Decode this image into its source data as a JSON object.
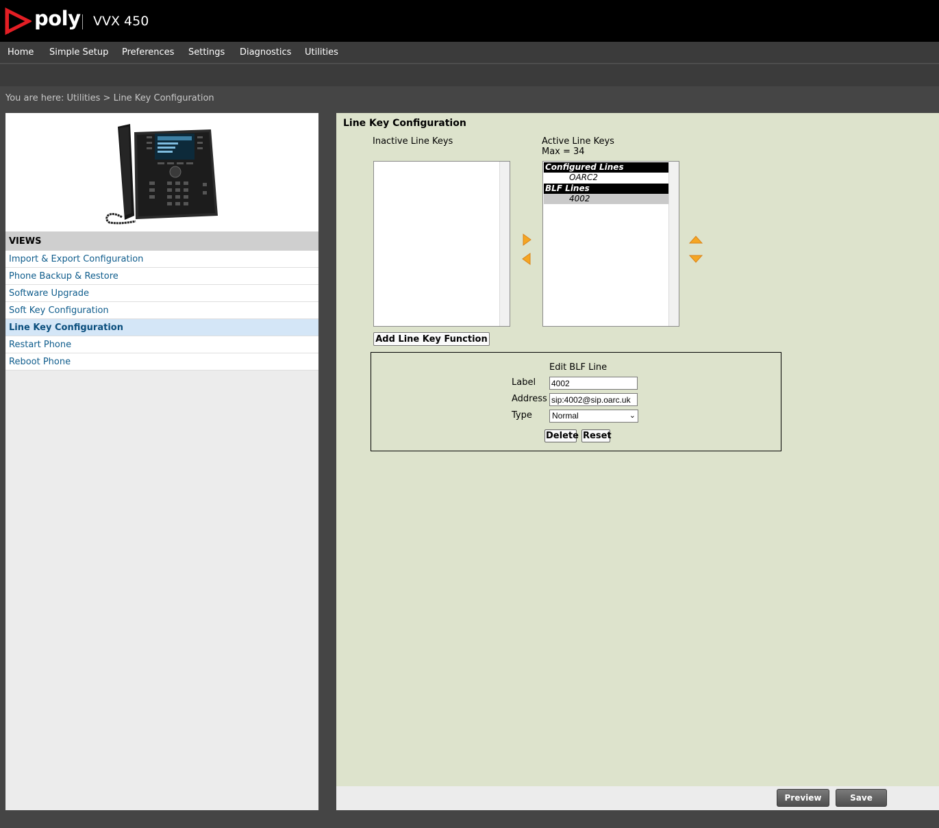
{
  "header": {
    "brand": "poly",
    "model": "VVX 450"
  },
  "nav": {
    "items": [
      "Home",
      "Simple Setup",
      "Preferences",
      "Settings",
      "Diagnostics",
      "Utilities"
    ]
  },
  "breadcrumb": "You are here: Utilities > Line Key Configuration",
  "sidebar": {
    "views_header": "VIEWS",
    "items": [
      "Import & Export Configuration",
      "Phone Backup & Restore",
      "Software Upgrade",
      "Soft Key Configuration",
      "Line Key Configuration",
      "Restart Phone",
      "Reboot Phone"
    ],
    "active_item": "Line Key Configuration"
  },
  "main": {
    "title": "Line Key Configuration",
    "inactive_label": "Inactive Line Keys",
    "active_label": "Active Line Keys",
    "active_max": "Max = 34",
    "active_list": {
      "group1": "Configured Lines",
      "item1": "OARC2",
      "group2": "BLF Lines",
      "item2": "4002",
      "selected": "4002"
    },
    "add_button": "Add Line Key Function",
    "edit": {
      "title": "Edit BLF Line",
      "label_label": "Label",
      "label_value": "4002",
      "address_label": "Address",
      "address_value": "sip:4002@sip.oarc.uk",
      "type_label": "Type",
      "type_value": "Normal",
      "delete_button": "Delete",
      "reset_button": "Reset"
    }
  },
  "footer": {
    "preview_button": "Preview",
    "save_button": "Save"
  },
  "colors": {
    "accent_arrow": "#f5a623",
    "content_bg": "#dde3cc",
    "link": "#0e5c8c"
  }
}
